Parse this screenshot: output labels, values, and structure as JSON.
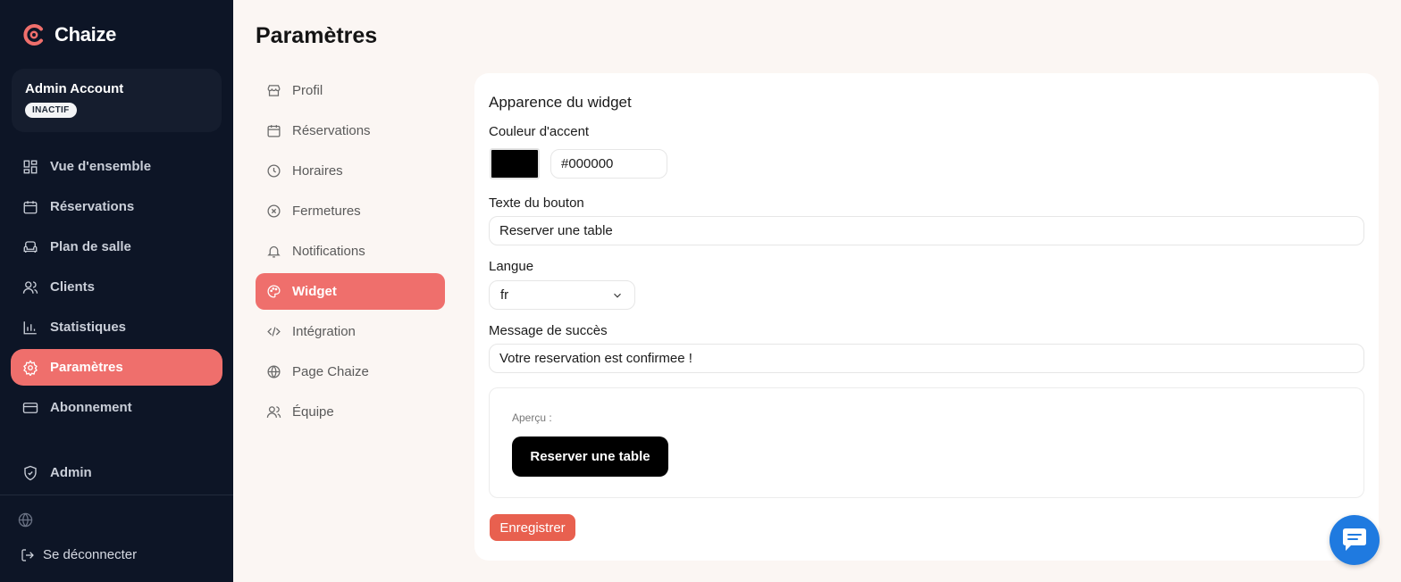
{
  "brand": {
    "name": "Chaize",
    "accent": "#ef6f6c"
  },
  "account": {
    "name": "Admin Account",
    "status": "INACTIF"
  },
  "sidebar": {
    "items": [
      {
        "label": "Vue d'ensemble",
        "icon": "dashboard-icon"
      },
      {
        "label": "Réservations",
        "icon": "calendar-icon"
      },
      {
        "label": "Plan de salle",
        "icon": "armchair-icon"
      },
      {
        "label": "Clients",
        "icon": "users-icon"
      },
      {
        "label": "Statistiques",
        "icon": "bar-chart-icon"
      },
      {
        "label": "Paramètres",
        "icon": "gear-icon",
        "active": true
      },
      {
        "label": "Abonnement",
        "icon": "credit-card-icon"
      }
    ],
    "admin": {
      "label": "Admin",
      "icon": "shield-icon"
    },
    "logout": "Se déconnecter"
  },
  "page": {
    "title": "Paramètres"
  },
  "settings_nav": {
    "items": [
      {
        "label": "Profil",
        "icon": "store-icon"
      },
      {
        "label": "Réservations",
        "icon": "calendar-icon"
      },
      {
        "label": "Horaires",
        "icon": "clock-icon"
      },
      {
        "label": "Fermetures",
        "icon": "circle-x-icon"
      },
      {
        "label": "Notifications",
        "icon": "bell-icon"
      },
      {
        "label": "Widget",
        "icon": "palette-icon",
        "active": true
      },
      {
        "label": "Intégration",
        "icon": "code-icon"
      },
      {
        "label": "Page Chaize",
        "icon": "globe-icon"
      },
      {
        "label": "Équipe",
        "icon": "users-icon"
      }
    ]
  },
  "widget": {
    "title": "Apparence du widget",
    "accent_label": "Couleur d'accent",
    "accent_value": "#000000",
    "button_text_label": "Texte du bouton",
    "button_text_value": "Reserver une table",
    "language_label": "Langue",
    "language_value": "fr",
    "success_label": "Message de succès",
    "success_value": "Votre reservation est confirmee !",
    "preview_label": "Aperçu :",
    "preview_button": "Reserver une table",
    "save_label": "Enregistrer"
  }
}
